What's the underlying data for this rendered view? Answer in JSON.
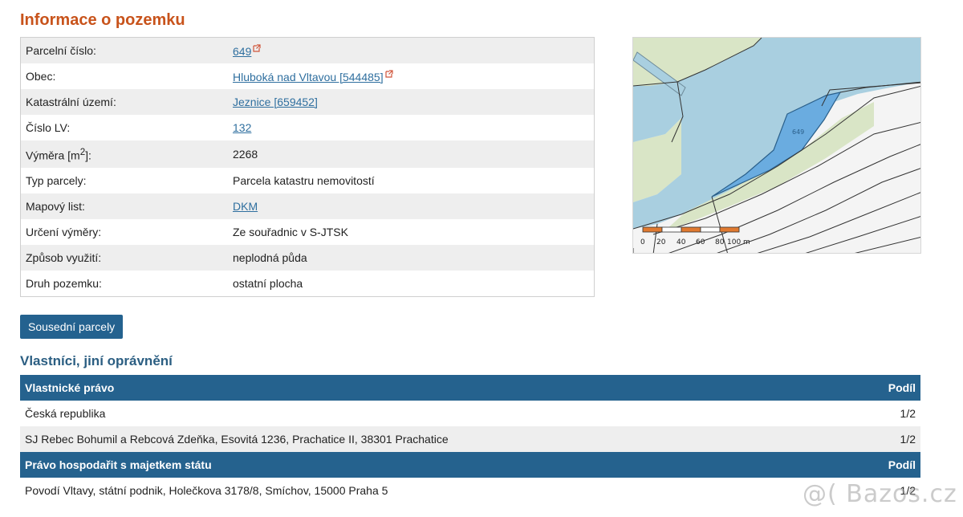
{
  "page_title": "Informace o pozemku",
  "info_rows": [
    {
      "label": "Parcelní číslo:",
      "value": "649",
      "link": true,
      "external": true
    },
    {
      "label": "Obec:",
      "value": "Hluboká nad Vltavou [544485]",
      "link": true,
      "external": true
    },
    {
      "label": "Katastrální území:",
      "value": "Jeznice [659452]",
      "link": true,
      "external": false
    },
    {
      "label": "Číslo LV:",
      "value": "132",
      "link": true,
      "external": false
    },
    {
      "label_main": "Výměra [m",
      "label_sup": "2",
      "label_end": "]:",
      "value": "2268",
      "link": false
    },
    {
      "label": "Typ parcely:",
      "value": "Parcela katastru nemovitostí",
      "link": false
    },
    {
      "label": "Mapový list:",
      "value": "DKM",
      "link": true,
      "external": false
    },
    {
      "label": "Určení výměry:",
      "value": "Ze souřadnic v S-JTSK",
      "link": false
    },
    {
      "label": "Způsob využití:",
      "value": "neplodná půda",
      "link": false
    },
    {
      "label": "Druh pozemku:",
      "value": "ostatní plocha",
      "link": false
    }
  ],
  "map": {
    "scale_labels": [
      "0",
      "20",
      "40",
      "60",
      "80",
      "100 m"
    ],
    "parcel_label": "649",
    "colors": {
      "water": "#a9cfe0",
      "grass": "#d9e5c6",
      "parcel": "#6aace0",
      "scale_orange": "#e07a30"
    }
  },
  "neighbors_button": "Sousední parcely",
  "owners_title": "Vlastníci, jiní oprávnění",
  "owner_sections": [
    {
      "header": "Vlastnické právo",
      "share_header": "Podíl",
      "rows": [
        {
          "name": "Česká republika",
          "share": "1/2"
        },
        {
          "name": "SJ Rebec Bohumil a Rebcová Zdeňka, Esovitá 1236, Prachatice II, 38301 Prachatice",
          "share": "1/2"
        }
      ]
    },
    {
      "header": "Právo hospodařit s majetkem státu",
      "share_header": "Podíl",
      "rows": [
        {
          "name": "Povodí Vltavy, státní podnik, Holečkova 3178/8, Smíchov, 15000 Praha 5",
          "share": "1/2"
        }
      ]
    }
  ],
  "watermark": "@( Bazos.cz"
}
